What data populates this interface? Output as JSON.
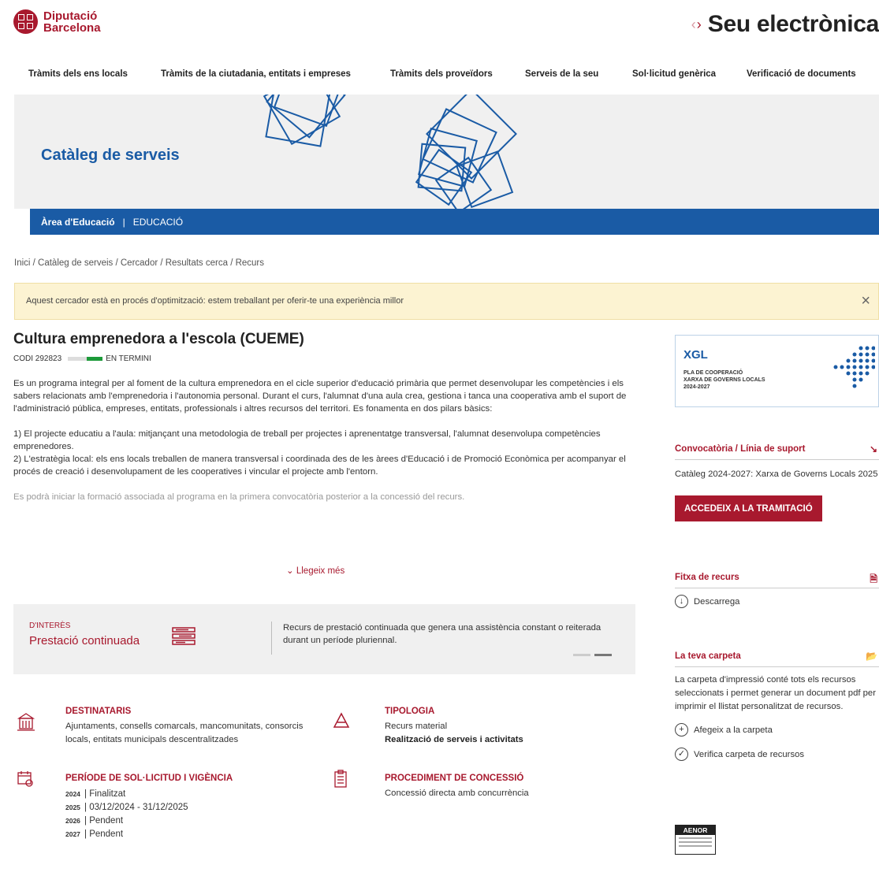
{
  "header": {
    "logo_line1": "Diputació",
    "logo_line2": "Barcelona",
    "site_title": "Seu electrònica",
    "brand_color": "#a8192e"
  },
  "nav": {
    "items": [
      "Tràmits dels ens locals",
      "Tràmits de la ciutadania, entitats i empreses",
      "Tràmits dels proveïdors",
      "Serveis de la seu",
      "Sol·licitud genèrica",
      "Verificació de documents"
    ]
  },
  "hero": {
    "title": "Catàleg de serveis",
    "area": "Àrea d'Educació",
    "separator": "|",
    "subarea": "EDUCACIÓ"
  },
  "breadcrumb": "Inici  /  Catàleg de serveis  /  Cercador  /  Resultats cerca  /  Recurs",
  "alert": {
    "text": "Aquest cercador està en procés d'optimització: estem treballant per oferir-te una experiència millor",
    "close_icon": "close-icon"
  },
  "resource": {
    "title": "Cultura emprenedora a l'escola (CUEME)",
    "code": "CODI 292823",
    "status": "EN TERMINI",
    "status_color": "#1c9a39",
    "p1": "Es un programa integral per al foment de la cultura emprenedora en el cicle superior d'educació primària que permet desenvolupar les competències i els sabers relacionats amb l'emprenedoria i l'autonomia personal. Durant el curs, l'alumnat d'una aula crea, gestiona i tanca una cooperativa amb el suport de l'administració pública, empreses, entitats, professionals i altres recursos del territori. Es fonamenta en dos pilars bàsics:",
    "p2": "1) El projecte educatiu a l'aula: mitjançant una metodologia de treball per projectes i aprenentatge transversal, l'alumnat desenvolupa competències emprenedores.",
    "p3": "2) L'estratègia local: els ens locals treballen de manera transversal i coordinada des de les àrees d'Educació i de Promoció Econòmica per acompanyar el procés de creació i desenvolupament de les cooperatives i vincular el projecte amb l'entorn.",
    "p4": "Es podrà iniciar la formació associada al programa en la primera convocatòria posterior a la concessió del recurs.",
    "read_more": "Llegeix més"
  },
  "interes": {
    "label": "D'INTERÈS",
    "value": "Prestació continuada",
    "text": "Recurs de prestació continuada que genera una assistència constant o reiterada durant un període pluriennal."
  },
  "details": {
    "destinataris_h": "DESTINATARIS",
    "destinataris_t": "Ajuntaments, consells comarcals, mancomunitats, consorcis locals, entitats municipals descentralitzades",
    "tipologia_h": "TIPOLOGIA",
    "tipologia_t1": "Recurs material",
    "tipologia_t2": "Realització de serveis i activitats",
    "periode_h": "PERÍODE DE SOL·LICITUD I VIGÈNCIA",
    "years": [
      {
        "year": "2024",
        "value": "Finalitzat"
      },
      {
        "year": "2025",
        "value": "03/12/2024 - 31/12/2025"
      },
      {
        "year": "2026",
        "value": "Pendent"
      },
      {
        "year": "2027",
        "value": "Pendent"
      }
    ],
    "proc_h": "PROCEDIMENT DE CONCESSIÓ",
    "proc_t": "Concessió directa amb concurrència"
  },
  "sidebar": {
    "xgl_title": "XGL",
    "xgl_sub1": "PLA DE COOPERACIÓ",
    "xgl_sub2": "XARXA DE GOVERNS LOCALS",
    "xgl_sub3": "2024-2027",
    "conv_h": "Convocatòria / Línia de suport",
    "conv_t": "Catàleg 2024-2027: Xarxa de Governs Locals 2025",
    "conv_btn": "ACCEDEIX A LA TRAMITACIÓ",
    "fitxa_h": "Fitxa de recurs",
    "fitxa_link": "Descarrega",
    "carpeta_h": "La teva carpeta",
    "carpeta_t": "La carpeta d'impressió conté tots els recursos seleccionats i permet generar un document pdf per imprimir el llistat personalitzat de recursos.",
    "carpeta_add": "Afegeix a la carpeta",
    "carpeta_verify": "Verifica carpeta de recursos",
    "aenor": "AENOR"
  }
}
